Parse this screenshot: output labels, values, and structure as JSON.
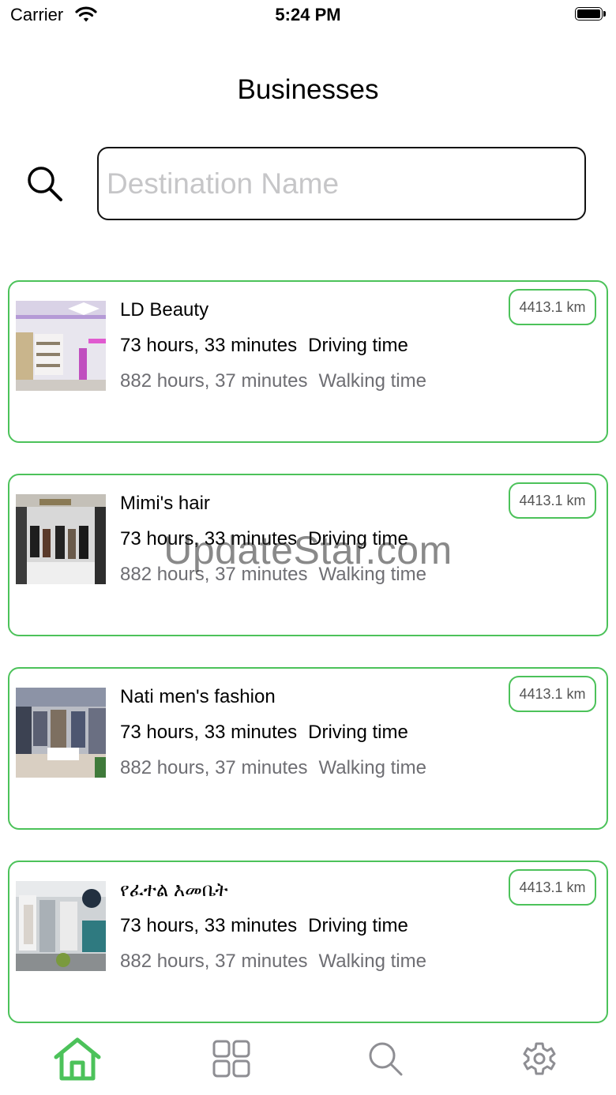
{
  "status_bar": {
    "carrier": "Carrier",
    "time": "5:24 PM"
  },
  "header": {
    "title": "Businesses"
  },
  "search": {
    "placeholder": "Destination Name",
    "value": ""
  },
  "businesses": [
    {
      "name": "LD Beauty",
      "driving_value": "73 hours, 33 minutes",
      "driving_label": "Driving time",
      "walking_value": "882 hours, 37 minutes",
      "walking_label": "Walking time",
      "distance": "4413.1 km"
    },
    {
      "name": "Mimi's hair",
      "driving_value": "73 hours, 33 minutes",
      "driving_label": "Driving time",
      "walking_value": "882 hours, 37 minutes",
      "walking_label": "Walking time",
      "distance": "4413.1 km"
    },
    {
      "name": "Nati men's fashion",
      "driving_value": "73 hours, 33 minutes",
      "driving_label": "Driving time",
      "walking_value": "882 hours, 37 minutes",
      "walking_label": "Walking time",
      "distance": "4413.1 km"
    },
    {
      "name": "የፈተል እመቤት",
      "driving_value": "73 hours, 33 minutes",
      "driving_label": "Driving time",
      "walking_value": "882 hours, 37 minutes",
      "walking_label": "Walking time",
      "distance": "4413.1 km"
    }
  ],
  "watermark": "UpdateStar.com",
  "tab_bar": {
    "active": "home",
    "tabs": [
      {
        "id": "home",
        "icon": "home-icon"
      },
      {
        "id": "categories",
        "icon": "grid-icon"
      },
      {
        "id": "search",
        "icon": "search-icon"
      },
      {
        "id": "settings",
        "icon": "gear-icon"
      }
    ]
  },
  "colors": {
    "accent": "#4cc25a",
    "inactive_icon": "#8e8e93",
    "secondary_text": "#6e6e73",
    "placeholder": "#c6c6c8"
  }
}
